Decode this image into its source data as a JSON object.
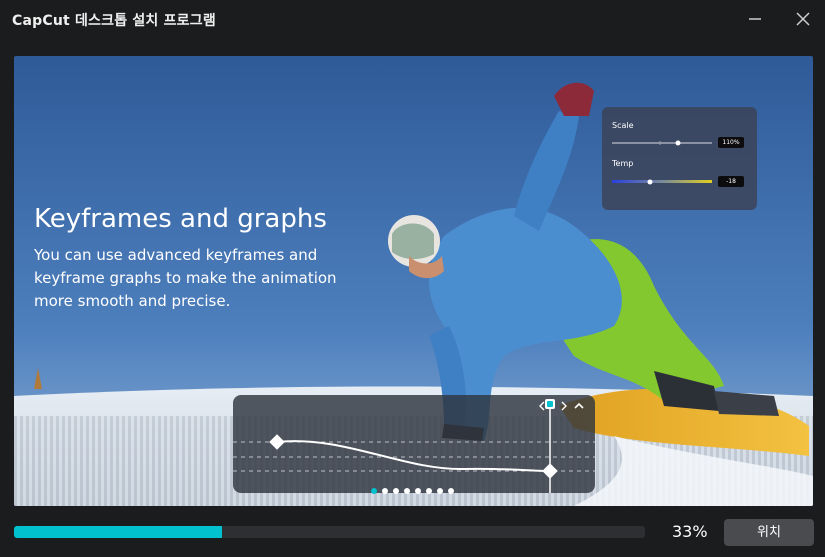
{
  "window": {
    "title": "CapCut 데스크톱 설치 프로그램"
  },
  "slide": {
    "headline": "Keyframes and graphs",
    "description": "You can use advanced keyframes and keyframe graphs to make the animation more smooth  and precise.",
    "params": {
      "scale_label": "Scale",
      "scale_value": "110%",
      "temp_label": "Temp",
      "temp_value": "-18"
    },
    "carousel": {
      "count": 8,
      "active_index": 0
    }
  },
  "progress": {
    "value": 0.33,
    "label": "33%"
  },
  "button": {
    "label": "위치"
  },
  "colors": {
    "accent": "#00c1cd",
    "background": "#1b1c1e",
    "button": "#4a4b4f"
  }
}
